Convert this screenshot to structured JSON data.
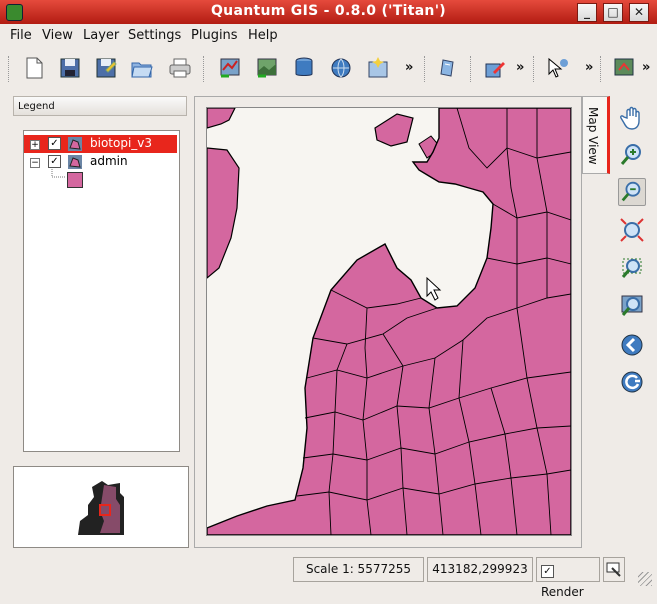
{
  "window": {
    "title": "Quantum GIS - 0.8.0 ('Titan')",
    "controls": [
      "_",
      "□",
      "✕"
    ]
  },
  "menu": [
    "File",
    "View",
    "Layer",
    "Settings",
    "Plugins",
    "Help"
  ],
  "toolbar": {
    "overflow": "»",
    "icons": [
      "new-project-icon",
      "save-project-icon",
      "save-as-icon",
      "open-project-icon",
      "print-icon",
      "add-vector-icon",
      "add-raster-icon",
      "add-postgis-icon",
      "add-wms-icon",
      "new-layer-icon",
      "identify-icon",
      "edit-icon",
      "select-icon",
      "capture-icon"
    ]
  },
  "legend": {
    "title": "Legend",
    "layers": [
      {
        "name": "biotopi_v3",
        "checked": true,
        "expand": "+",
        "selected": true
      },
      {
        "name": "admin",
        "checked": true,
        "expand": "−",
        "selected": false
      }
    ],
    "symbol_color": "#d4679f"
  },
  "map": {
    "tab_label": "Map View",
    "fill": "#d4679f",
    "water": "#f7f5f1"
  },
  "status": {
    "scale": "Scale 1: 5577255",
    "coords": "413182,299923",
    "render_label": "Render",
    "render_checked": true
  }
}
